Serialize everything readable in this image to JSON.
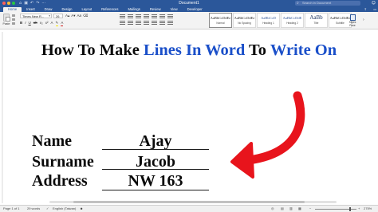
{
  "window": {
    "title": "Document1",
    "search_placeholder": "Search in Document"
  },
  "tabs": [
    {
      "label": "Home",
      "active": true
    },
    {
      "label": "Insert"
    },
    {
      "label": "Draw"
    },
    {
      "label": "Design"
    },
    {
      "label": "Layout"
    },
    {
      "label": "References"
    },
    {
      "label": "Mailings"
    },
    {
      "label": "Review"
    },
    {
      "label": "View"
    },
    {
      "label": "Developer"
    }
  ],
  "ribbon": {
    "paste_label": "Paste",
    "font_name": "Times New R...",
    "font_size": "26",
    "styles": [
      {
        "preview": "AaBbCcDdEe",
        "name": "Normal",
        "selected": true
      },
      {
        "preview": "AaBbCcDdEe",
        "name": "No Spacing"
      },
      {
        "preview": "AaBbCcD",
        "name": "Heading 1"
      },
      {
        "preview": "AaBbCcDdE",
        "name": "Heading 2"
      },
      {
        "preview": "AaBb",
        "name": "Title"
      },
      {
        "preview": "AaBbCcDdEe",
        "name": "Subtitle"
      }
    ],
    "styles_pane_label": "Styles Pane"
  },
  "document": {
    "heading_parts": [
      {
        "text": "How To Make ",
        "color": "#0a0a0a"
      },
      {
        "text": "Lines In Word",
        "color": "#1a4fc9"
      },
      {
        "text": " To ",
        "color": "#0a0a0a"
      },
      {
        "text": "Write On",
        "color": "#1a4fc9"
      }
    ],
    "fields": [
      {
        "label": "Name",
        "value": "Ajay"
      },
      {
        "label": "Surname",
        "value": "Jacob"
      },
      {
        "label": "Address",
        "value": "NW 163"
      }
    ],
    "arrow_color": "#e8141c"
  },
  "status": {
    "page": "Page 1 of 1",
    "words": "29 words",
    "language": "English (Taiwan)",
    "zoom": "275%",
    "zoom_fraction": 0.82
  },
  "colors": {
    "ribbon_blue": "#2b579a",
    "accent_blue_text": "#1a4fc9"
  },
  "icons": [
    "search-icon",
    "paste-icon",
    "styles-pane-icon",
    "red-curved-arrow-icon",
    "focus-icon",
    "print-layout-icon",
    "web-layout-icon"
  ]
}
